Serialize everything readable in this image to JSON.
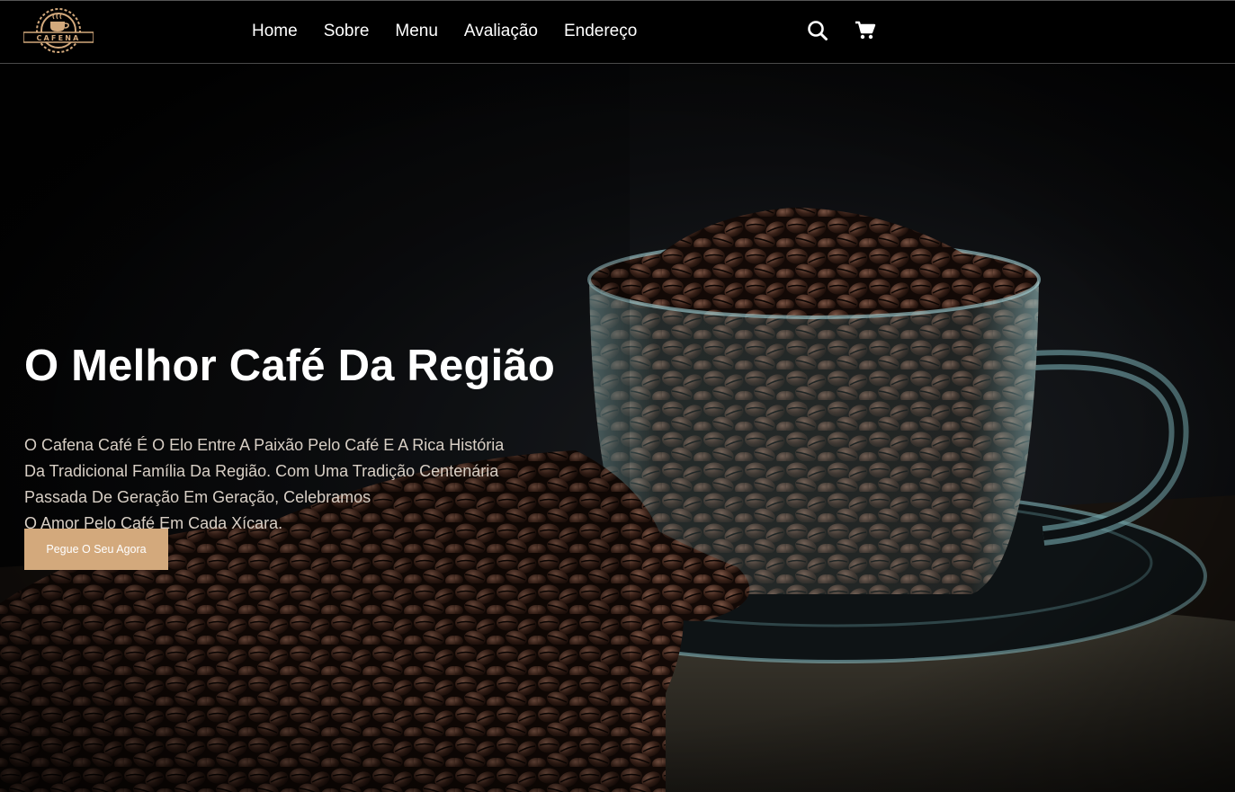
{
  "brand": {
    "name": "CAFENA",
    "logo_icon": "coffee-cup-gear-logo"
  },
  "nav": {
    "items": [
      {
        "label": "Home"
      },
      {
        "label": "Sobre"
      },
      {
        "label": "Menu"
      },
      {
        "label": "Avaliação"
      },
      {
        "label": "Endereço"
      }
    ]
  },
  "header_icons": {
    "search": "search-icon",
    "cart": "cart-icon"
  },
  "hero": {
    "title": "O Melhor Café Da Região",
    "lines": [
      "O Cafena Café É O Elo Entre A Paixão Pelo Café E A Rica História",
      "Da Tradicional Família Da Região. Com Uma Tradição Centenária",
      "Passada De Geração Em Geração, Celebramos",
      "O Amor Pelo Café Em Cada Xícara."
    ],
    "cta_label": "Pegue O Seu Agora"
  },
  "colors": {
    "accent": "#d3a97c",
    "background": "#000000",
    "text": "#ffffff"
  }
}
